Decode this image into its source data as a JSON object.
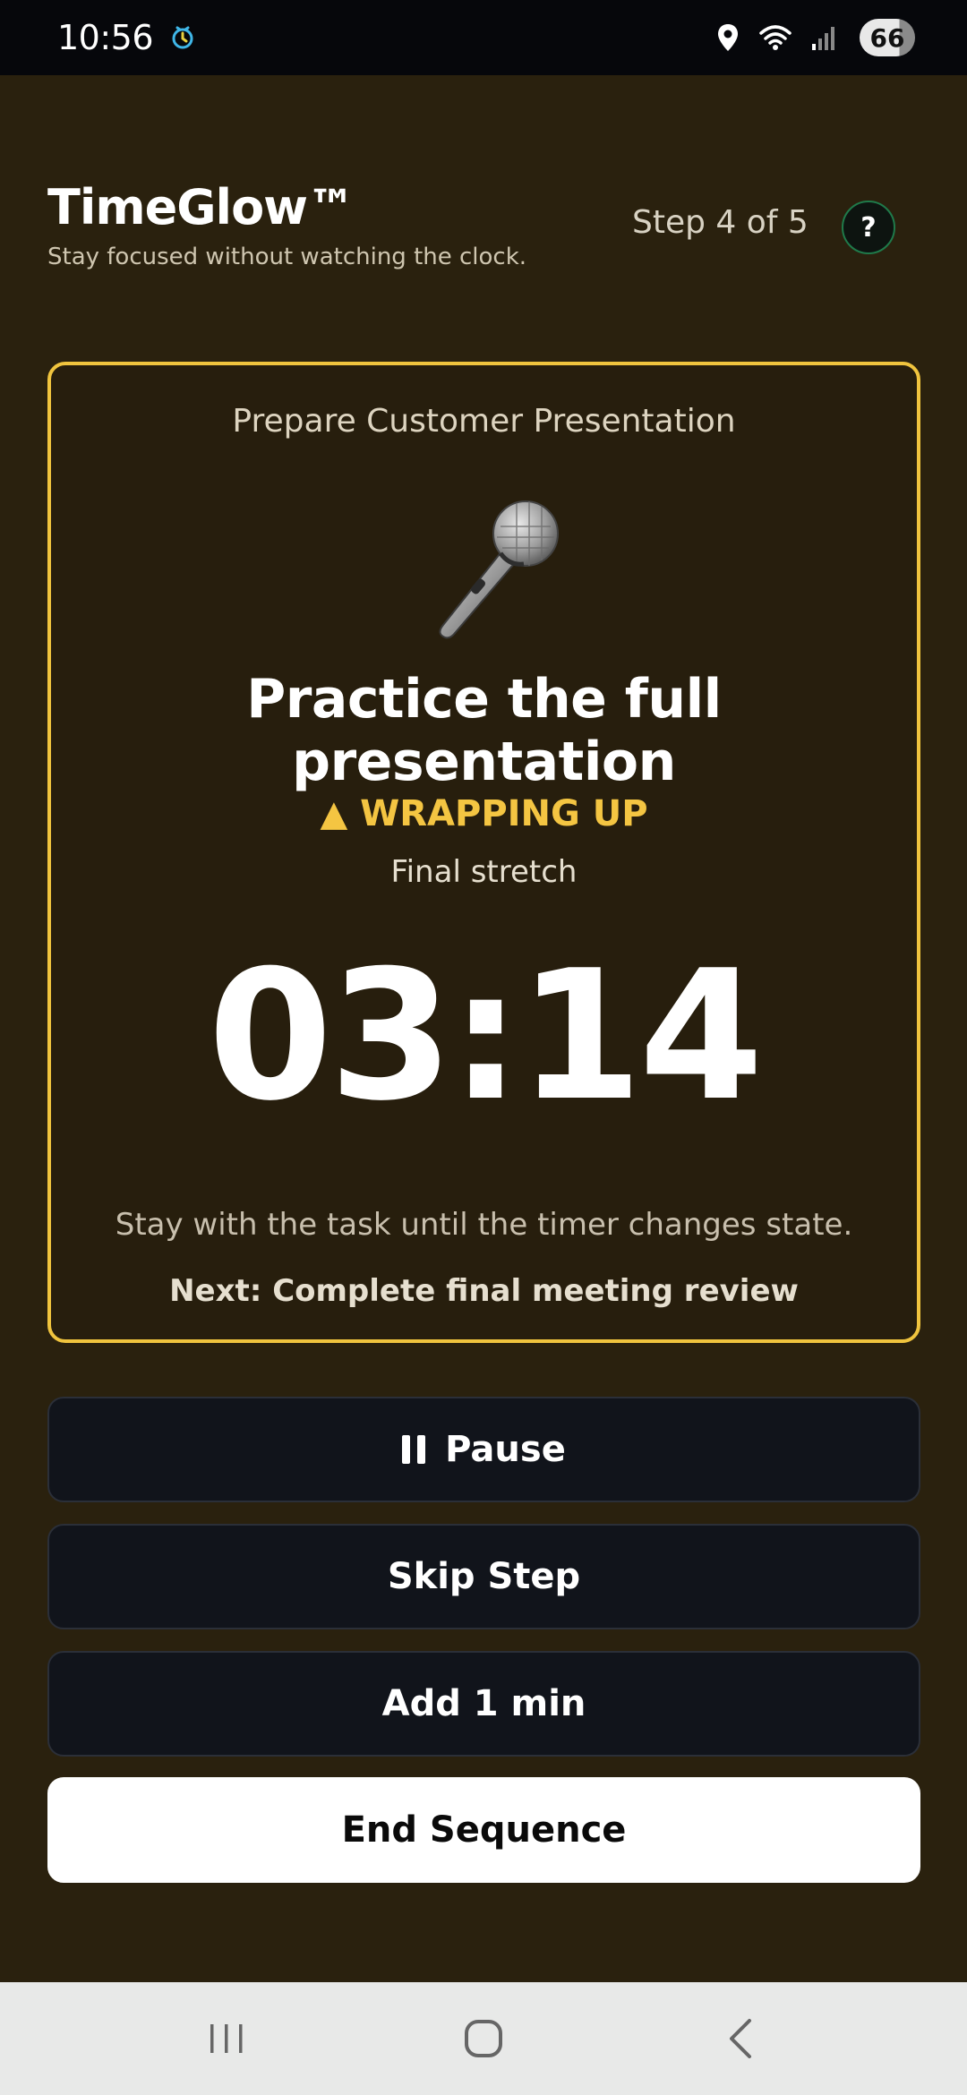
{
  "status_bar": {
    "time": "10:56",
    "battery": "66"
  },
  "header": {
    "app_title": "TimeGlow™",
    "tagline": "Stay focused without watching the clock.",
    "step": "Step 4 of 5",
    "help_label": "?"
  },
  "card": {
    "sequence_title": "Prepare Customer Presentation",
    "task_icon": "microphone-icon",
    "task_title": "Practice the full presentation",
    "state_label": "▲ WRAPPING UP",
    "state_sub": "Final stretch",
    "timer": "03:14",
    "hint": "Stay with the task until the timer changes state.",
    "next": "Next: Complete final meeting review",
    "accent_color": "#f0c43e"
  },
  "actions": {
    "pause": "Pause",
    "skip": "Skip Step",
    "add": "Add 1 min",
    "end": "End Sequence"
  },
  "nav": {
    "recents": "recents-icon",
    "home": "home-icon",
    "back": "back-icon"
  }
}
